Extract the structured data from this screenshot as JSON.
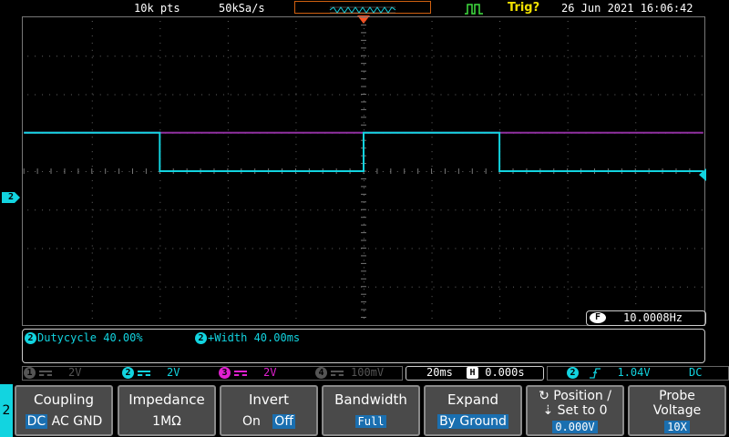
{
  "status": {
    "record_length": "10k pts",
    "sample_rate": "50kSa/s",
    "trigger_status": "Trig?",
    "datetime": "26 Jun 2021 16:06:42"
  },
  "frequency": {
    "label": "F",
    "value": "10.0008Hz"
  },
  "measurements": [
    {
      "channel": "2",
      "text": "Dutycycle 40.00%"
    },
    {
      "channel": "2",
      "text": "+Width 40.00ms"
    }
  ],
  "channels": [
    {
      "num": "1",
      "scale": "2V",
      "color": "#555555"
    },
    {
      "num": "2",
      "scale": "2V",
      "color": "#12d4e0"
    },
    {
      "num": "3",
      "scale": "2V",
      "color": "#e020d0"
    },
    {
      "num": "4",
      "scale": "100mV",
      "color": "#555555"
    }
  ],
  "timebase": {
    "scale": "20ms",
    "h_label": "H",
    "delay": "0.000s"
  },
  "trigger": {
    "channel": "2",
    "slope": "rising",
    "level": "1.04V",
    "coupling": "DC"
  },
  "ch_marker": "2",
  "menu": {
    "channel_tab": "2",
    "coupling": {
      "title": "Coupling",
      "options": [
        "DC",
        "AC",
        "GND"
      ],
      "selected": "DC"
    },
    "impedance": {
      "title": "Impedance",
      "value": "1MΩ"
    },
    "invert": {
      "title": "Invert",
      "options": [
        "On",
        "Off"
      ],
      "selected": "Off"
    },
    "bandwidth": {
      "title": "Bandwidth",
      "value": "Full"
    },
    "expand": {
      "title": "Expand",
      "value": "By Ground"
    },
    "position": {
      "title_line1": "Position /",
      "title_line2": "Set to 0",
      "value": "0.000V"
    },
    "probe": {
      "title_line1": "Probe",
      "title_line2": "Voltage",
      "value": "10X"
    }
  },
  "waveforms": {
    "ch2": {
      "high_level_div": 1,
      "low_level_div": 0,
      "rising_edges_div": [
        5
      ],
      "falling_edges_div": [
        2,
        7
      ]
    },
    "ch3": {
      "level_div": 1
    }
  },
  "colors": {
    "ch2": "#12d4e0",
    "ch3": "#9030a0",
    "grid": "#777777",
    "softkey_bg": "#4a4a4a",
    "selected": "#1a6fb0",
    "trigger": "#f0e000"
  }
}
